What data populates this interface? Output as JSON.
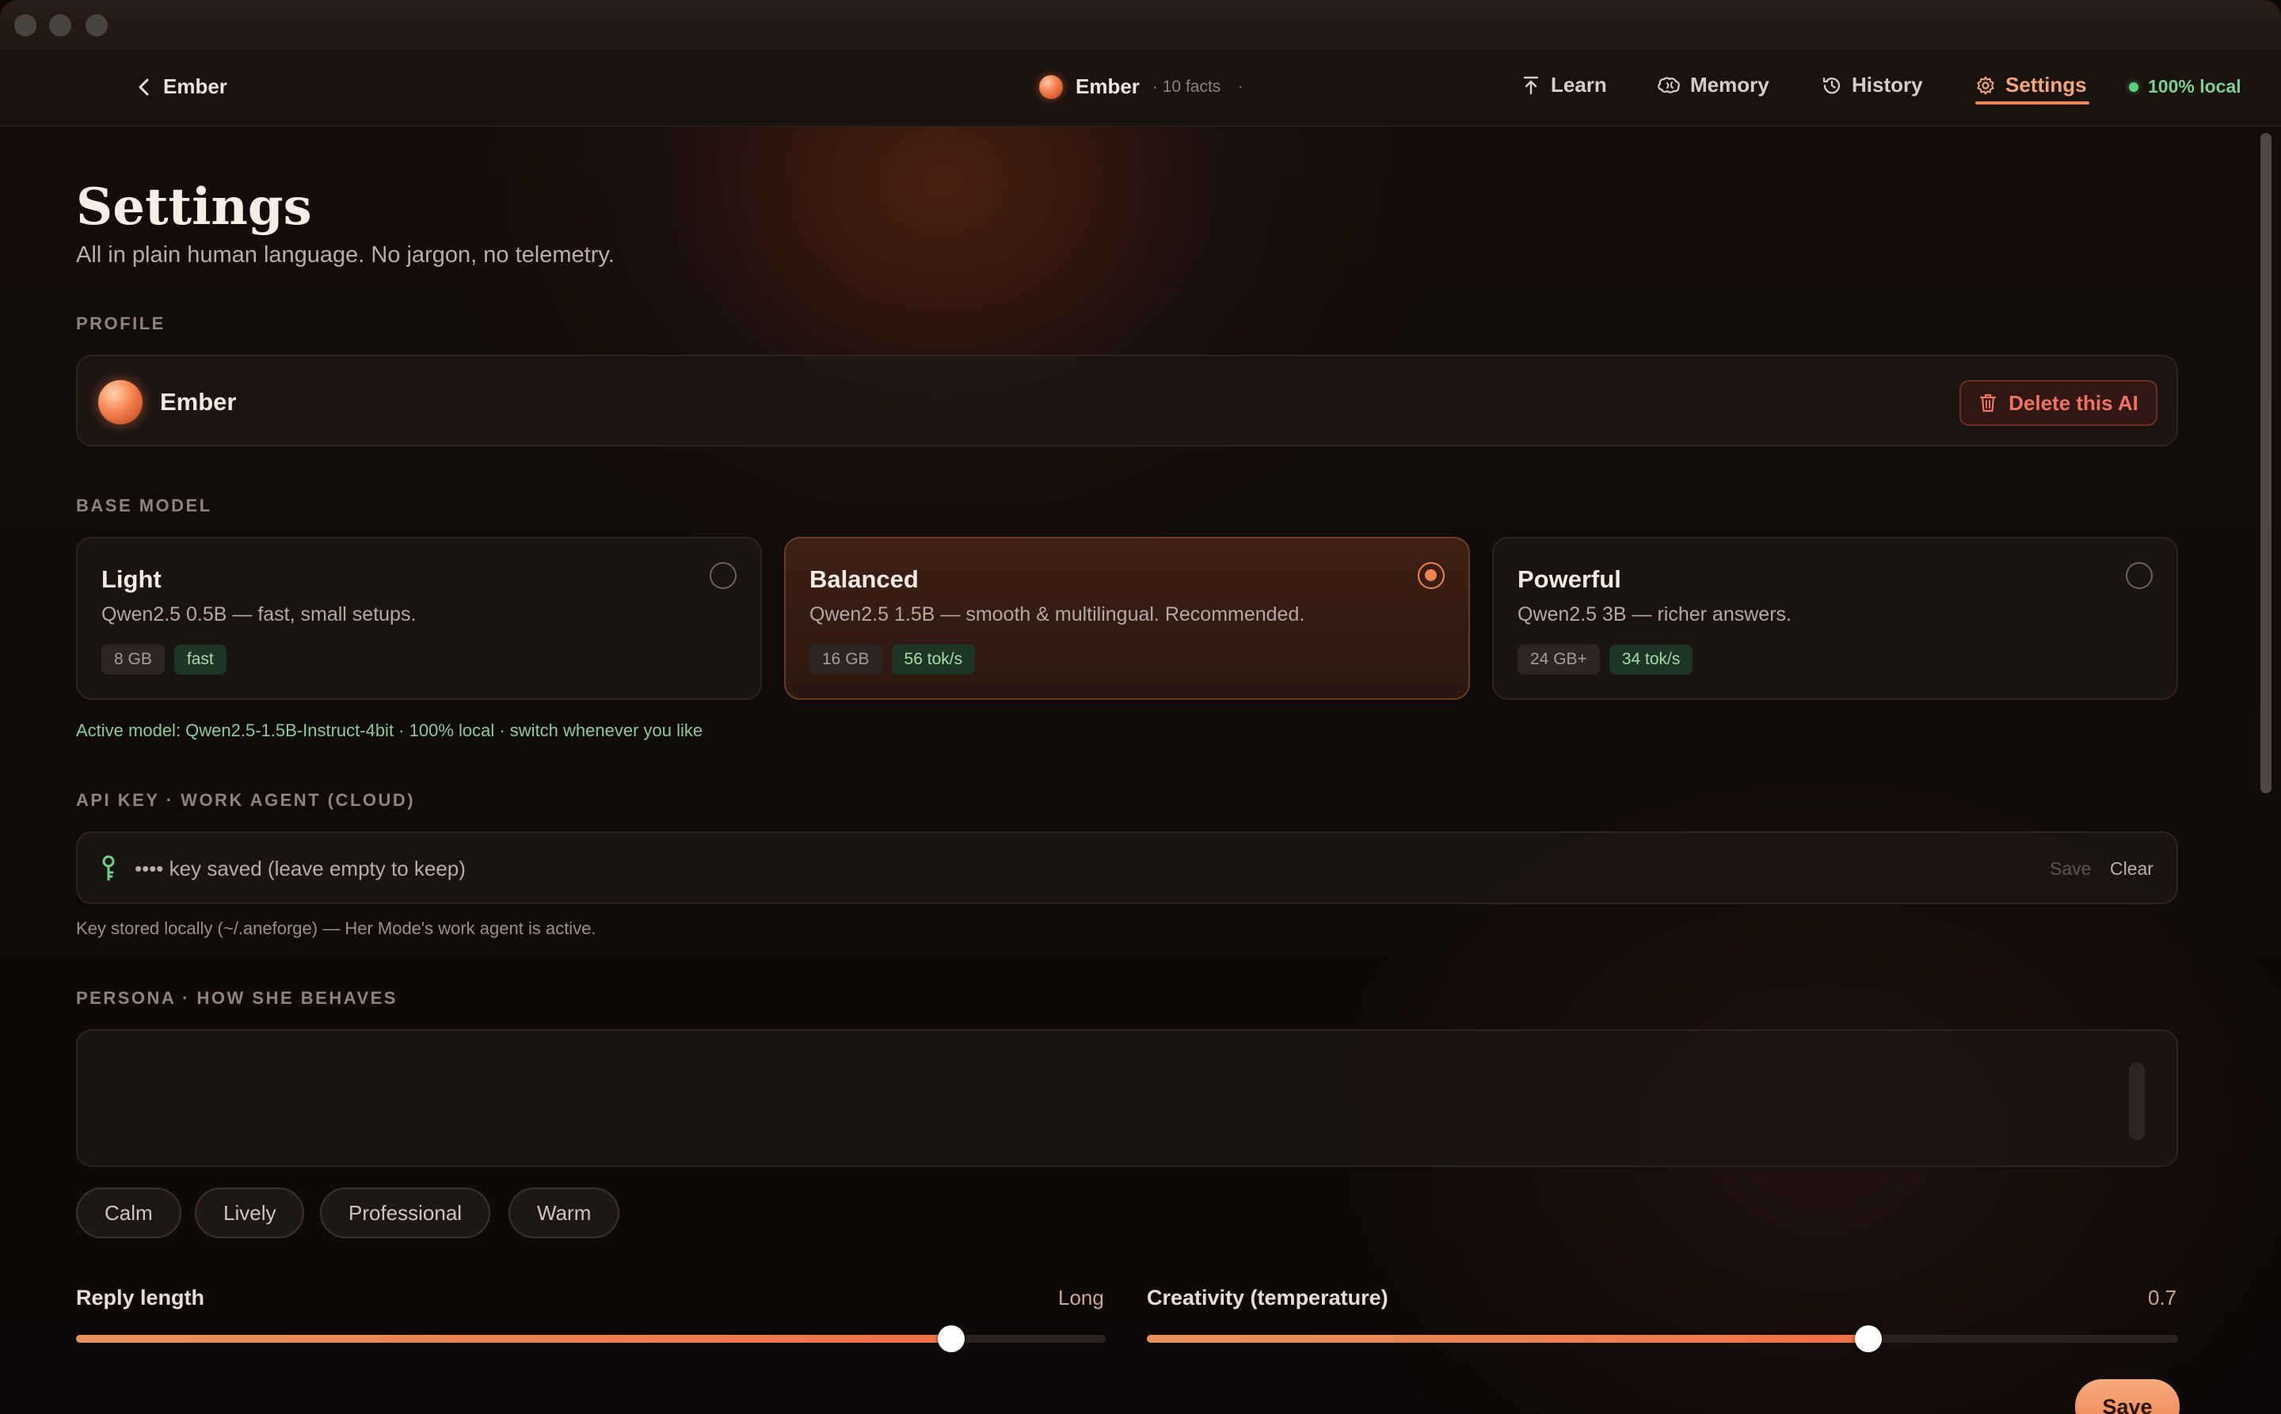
{
  "topnav": {
    "back_label": "Ember",
    "brand_name": "Ember",
    "brand_facts": "· 10 facts",
    "brand_dot": "·",
    "tabs": [
      {
        "label": "Learn",
        "icon": "upload-arrow-icon"
      },
      {
        "label": "Memory",
        "icon": "brain-icon"
      },
      {
        "label": "History",
        "icon": "clock-history-icon"
      },
      {
        "label": "Settings",
        "icon": "gear-icon",
        "active": true
      }
    ],
    "status": "100% local"
  },
  "page": {
    "title": "Settings",
    "subtitle": "All in plain human language. No jargon, no telemetry."
  },
  "profile": {
    "section_label": "PROFILE",
    "name": "Ember",
    "delete_label": "Delete this AI"
  },
  "base_model": {
    "section_label": "BASE MODEL",
    "options": [
      {
        "title": "Light",
        "desc": "Qwen2.5 0.5B — fast, small setups.",
        "memory": "8 GB",
        "speed": "fast",
        "selected": false
      },
      {
        "title": "Balanced",
        "desc": "Qwen2.5 1.5B — smooth & multilingual. Recommended.",
        "memory": "16 GB",
        "speed": "56 tok/s",
        "selected": true
      },
      {
        "title": "Powerful",
        "desc": "Qwen2.5 3B — richer answers.",
        "memory": "24 GB+",
        "speed": "34 tok/s",
        "selected": false
      }
    ],
    "active_note": "Active model: Qwen2.5-1.5B-Instruct-4bit · 100% local · switch whenever you like"
  },
  "api_key": {
    "section_label": "API KEY · WORK AGENT (CLOUD)",
    "placeholder": "•••• key saved (leave empty to keep)",
    "save_label": "Save",
    "clear_label": "Clear",
    "note": "Key stored locally (~/.aneforge) — Her Mode's work agent is active."
  },
  "persona": {
    "section_label": "PERSONA · HOW SHE BEHAVES",
    "text": "",
    "tones": [
      "Calm",
      "Lively",
      "Professional",
      "Warm"
    ]
  },
  "sliders": {
    "reply_length": {
      "label": "Reply length",
      "value_label": "Long",
      "fraction": 0.85
    },
    "creativity": {
      "label": "Creativity (temperature)",
      "value_label": "0.7",
      "fraction": 0.7
    }
  },
  "footer": {
    "save_label": "Save"
  },
  "colors": {
    "accent": "#ef8452",
    "local_green": "#5fd07a",
    "danger": "#f0735f"
  }
}
